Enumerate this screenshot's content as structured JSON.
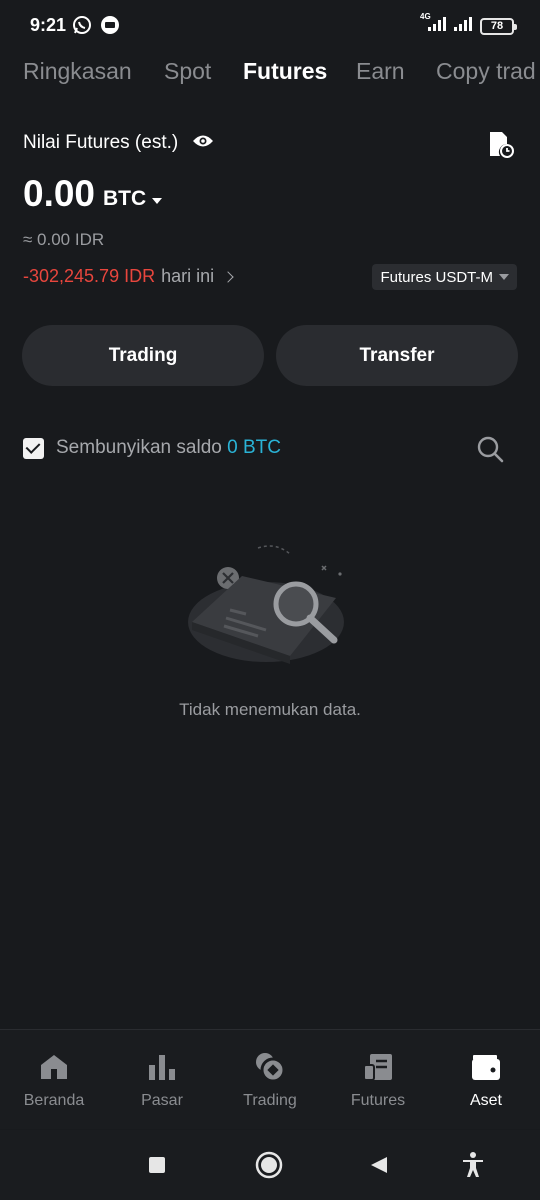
{
  "status_bar": {
    "time": "9:21",
    "icons": [
      "whatsapp-icon",
      "notification-icon"
    ],
    "network": "4G",
    "battery": "78"
  },
  "tabs": [
    {
      "label": "Ringkasan",
      "active": false
    },
    {
      "label": "Spot",
      "active": false
    },
    {
      "label": "Futures",
      "active": true
    },
    {
      "label": "Earn",
      "active": false
    },
    {
      "label": "Copy trad",
      "active": false
    }
  ],
  "header": {
    "title": "Nilai Futures (est.)",
    "eye_icon": "eye-icon",
    "history_icon": "document-clock-icon"
  },
  "balance": {
    "value": "0.00",
    "unit": "BTC",
    "approx": "≈ 0.00 IDR",
    "pnl_value": "-302,245.79 IDR",
    "pnl_label": "hari ini",
    "selector": "Futures USDT-M"
  },
  "actions": {
    "trading": "Trading",
    "transfer": "Transfer"
  },
  "filter": {
    "hide_label": "Sembunyikan saldo",
    "hide_value": "0 BTC",
    "checked": true
  },
  "empty": {
    "text": "Tidak menemukan data."
  },
  "bottom_nav": [
    {
      "label": "Beranda",
      "icon": "home-icon",
      "active": false
    },
    {
      "label": "Pasar",
      "icon": "bar-chart-icon",
      "active": false
    },
    {
      "label": "Trading",
      "icon": "coins-icon",
      "active": false
    },
    {
      "label": "Futures",
      "icon": "futures-icon",
      "active": false
    },
    {
      "label": "Aset",
      "icon": "wallet-icon",
      "active": true
    }
  ],
  "colors": {
    "background": "#181a1d",
    "negative": "#e8463d",
    "accent": "#2ab3d6"
  }
}
